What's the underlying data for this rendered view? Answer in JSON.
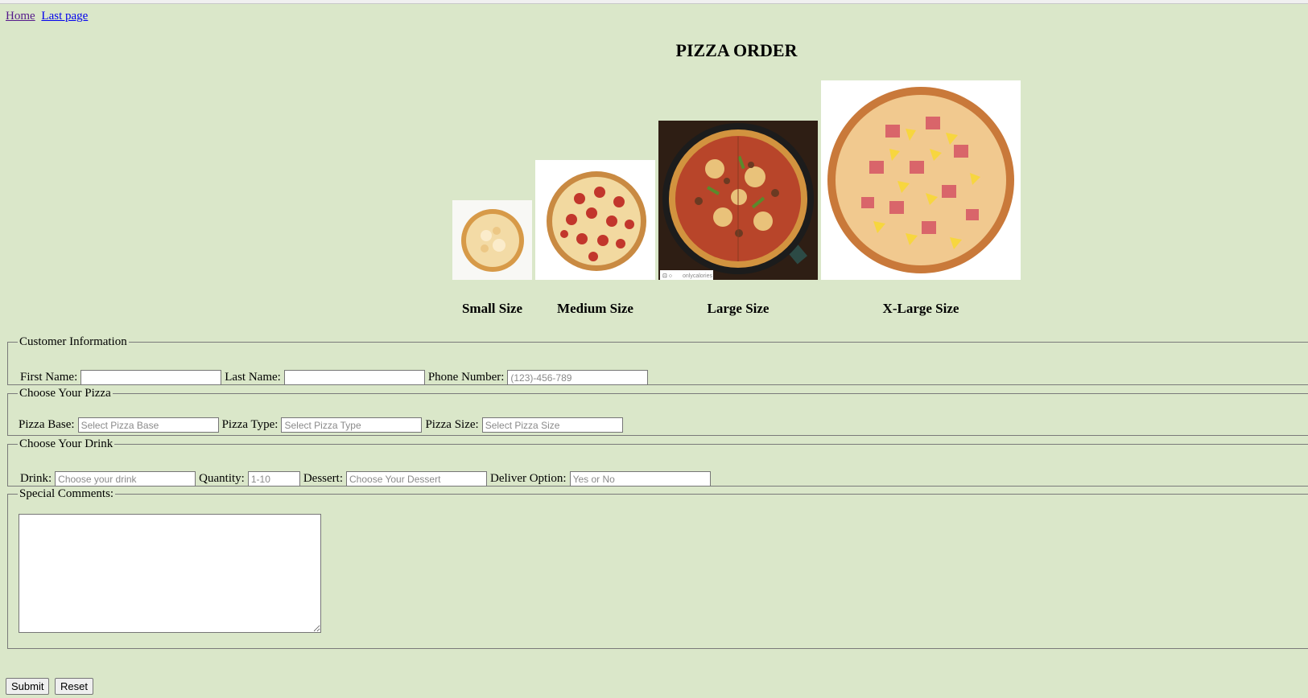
{
  "nav": {
    "home_link": "Home",
    "last_page_link": "Last page"
  },
  "page_title": "PIZZA ORDER",
  "sizes": [
    {
      "label": "Small Size",
      "image_icon": "cheese-pizza-icon"
    },
    {
      "label": "Medium Size",
      "image_icon": "pepperoni-pizza-icon"
    },
    {
      "label": "Large Size",
      "image_icon": "supreme-pizza-icon"
    },
    {
      "label": "X-Large Size",
      "image_icon": "hawaiian-pizza-icon"
    }
  ],
  "photo_watermark": "onlycalories",
  "customer": {
    "legend": "Customer Information",
    "first_name_label": "First Name:",
    "first_name_value": "",
    "last_name_label": "Last Name:",
    "last_name_value": "",
    "phone_label": "Phone Number:",
    "phone_placeholder": "(123)-456-789"
  },
  "pizza": {
    "legend": "Choose Your Pizza",
    "base_label": "Pizza Base:",
    "base_placeholder": "Select Pizza Base",
    "type_label": "Pizza Type:",
    "type_placeholder": "Select Pizza Type",
    "size_label": "Pizza Size:",
    "size_placeholder": "Select Pizza Size"
  },
  "drink": {
    "legend": "Choose Your Drink",
    "drink_label": "Drink:",
    "drink_placeholder": "Choose your drink",
    "quantity_label": "Quantity:",
    "quantity_placeholder": "1-10",
    "dessert_label": "Dessert:",
    "dessert_placeholder": "Choose Your Dessert",
    "deliver_label": "Deliver Option:",
    "deliver_placeholder": "Yes or No"
  },
  "comments": {
    "legend": "Special Comments:",
    "value": ""
  },
  "buttons": {
    "submit_label": "Submit",
    "reset_label": "Reset"
  },
  "colors": {
    "page_background": "#dae7c9",
    "link": "#0000ee",
    "visited_link": "#551a8b"
  }
}
